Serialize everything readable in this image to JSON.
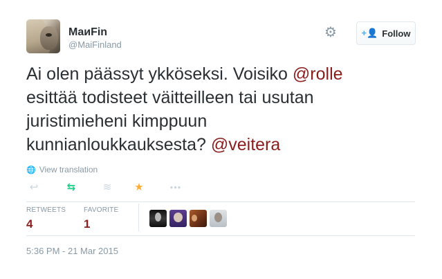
{
  "user": {
    "display_name": "MaиFin",
    "handle": "@MaiFinland"
  },
  "follow_button": {
    "label": "Follow",
    "icon": "add-user-icon"
  },
  "settings_icon": "gear-icon",
  "tweet": {
    "line1_text": "Ai olen päässyt ykköseksi. Voisiko ",
    "mention1": "@rolle",
    "line2_text": "esittää todisteet väitteilleen tai usutan",
    "line3_text": "juristimieheni kimppuun",
    "line4_text": "kunnianloukkauksesta? ",
    "mention2": "@veitera"
  },
  "translation_link": "View translation",
  "actions": [
    "reply-icon",
    "retweet-icon",
    "add-to-collection-icon",
    "favorite-icon",
    "more-icon"
  ],
  "stats": {
    "retweets_label": "RETWEETS",
    "retweets_count": "4",
    "favorites_label": "FAVORITE",
    "favorites_count": "1"
  },
  "timestamp": "5:36 PM - 21 Mar 2015",
  "colors": {
    "mention": "#8b1d1d",
    "retweet_active": "#19cf86",
    "favorite_active": "#ffac33",
    "muted": "#8899a6",
    "follow_accent": "#55acee"
  }
}
